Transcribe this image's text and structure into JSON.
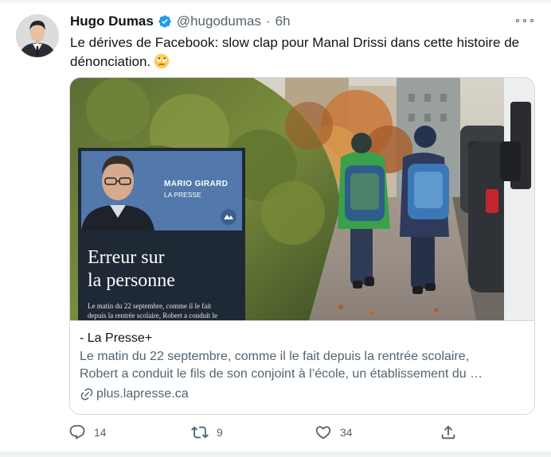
{
  "tweet": {
    "author": {
      "display_name": "Hugo Dumas",
      "handle": "@hugodumas",
      "separator": "·",
      "time": "6h",
      "verified": true
    },
    "text": "Le dérives de Facebook: slow clap pour Manal Drissi dans cette histoire de dénonciation.",
    "emoji": "face-with-rolling-eyes"
  },
  "card": {
    "image_overlay": {
      "author_name": "MARIO GIRARD",
      "publication": "LA PRESSE",
      "headline_line1": "Erreur sur",
      "headline_line2": "la personne",
      "lead_line1": "Le matin du 22 septembre, comme il le fait",
      "lead_line2": "depuis la rentrée scolaire, Robert a conduit le"
    },
    "source": "- La Presse+",
    "description_line1": "Le matin du 22 septembre, comme il le fait depuis la rentrée scolaire,",
    "description_line2": "Robert a conduit le fils de son conjoint à l’école, un établissement du …",
    "domain": "plus.lapresse.ca"
  },
  "actions": {
    "reply_count": "14",
    "retweet_count": "9",
    "like_count": "34"
  },
  "colors": {
    "text_primary": "#0f1419",
    "text_secondary": "#536471",
    "verified_blue": "#1d9bf0",
    "border": "#cfd9de"
  },
  "icons": [
    "verified-badge-icon",
    "more-options-icon",
    "link-icon",
    "reply-icon",
    "retweet-icon",
    "like-icon",
    "share-icon"
  ]
}
